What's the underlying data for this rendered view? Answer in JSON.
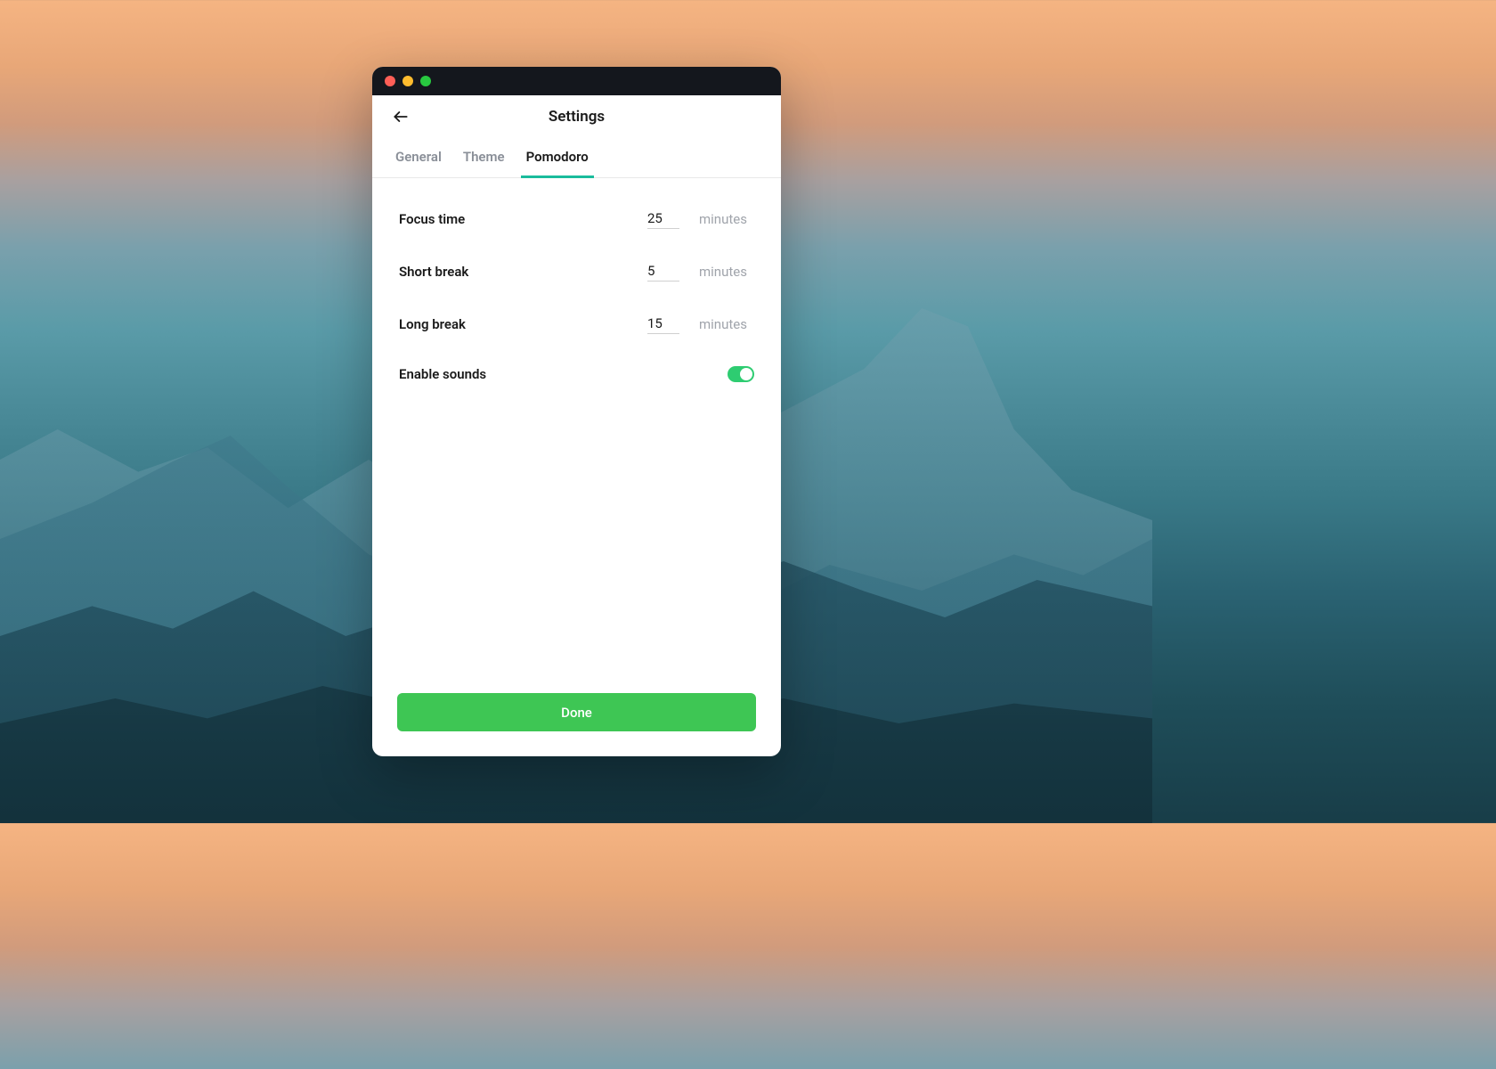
{
  "header": {
    "title": "Settings"
  },
  "tabs": [
    {
      "label": "General",
      "active": false
    },
    {
      "label": "Theme",
      "active": false
    },
    {
      "label": "Pomodoro",
      "active": true
    }
  ],
  "settings": {
    "focus_time": {
      "label": "Focus time",
      "value": "25",
      "unit": "minutes"
    },
    "short_break": {
      "label": "Short break",
      "value": "5",
      "unit": "minutes"
    },
    "long_break": {
      "label": "Long break",
      "value": "15",
      "unit": "minutes"
    },
    "enable_sounds": {
      "label": "Enable sounds",
      "value": true
    }
  },
  "footer": {
    "done_label": "Done"
  },
  "colors": {
    "accent": "#1abc9c",
    "primary_button": "#3ec654",
    "toggle_on": "#2ecc71"
  }
}
